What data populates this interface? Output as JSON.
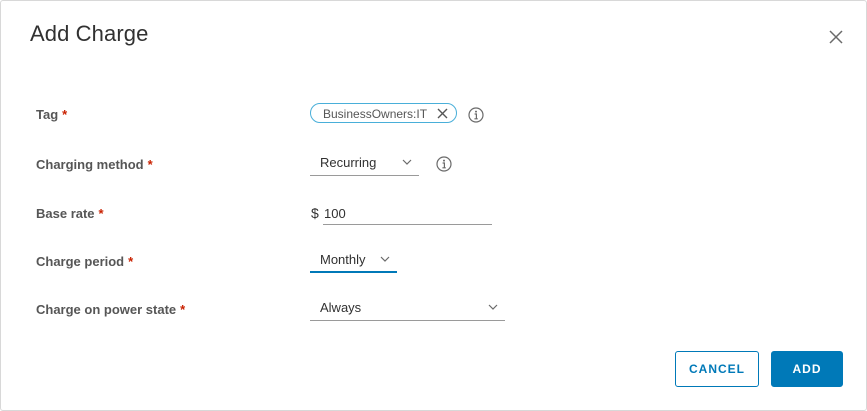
{
  "dialog": {
    "title": "Add Charge",
    "close_icon": "close-icon"
  },
  "form": {
    "required_marker": "*",
    "tag": {
      "label": "Tag",
      "chip_value": "BusinessOwners:IT",
      "info_icon": "info-icon"
    },
    "charging_method": {
      "label": "Charging method",
      "value": "Recurring",
      "info_icon": "info-icon"
    },
    "base_rate": {
      "label": "Base rate",
      "currency": "$",
      "value": "100"
    },
    "charge_period": {
      "label": "Charge period",
      "value": "Monthly"
    },
    "charge_on_power_state": {
      "label": "Charge on power state",
      "value": "Always"
    }
  },
  "footer": {
    "cancel_label": "CANCEL",
    "add_label": "ADD"
  },
  "colors": {
    "primary": "#0079b8",
    "required": "#c92100",
    "chip_border": "#49afd9"
  }
}
